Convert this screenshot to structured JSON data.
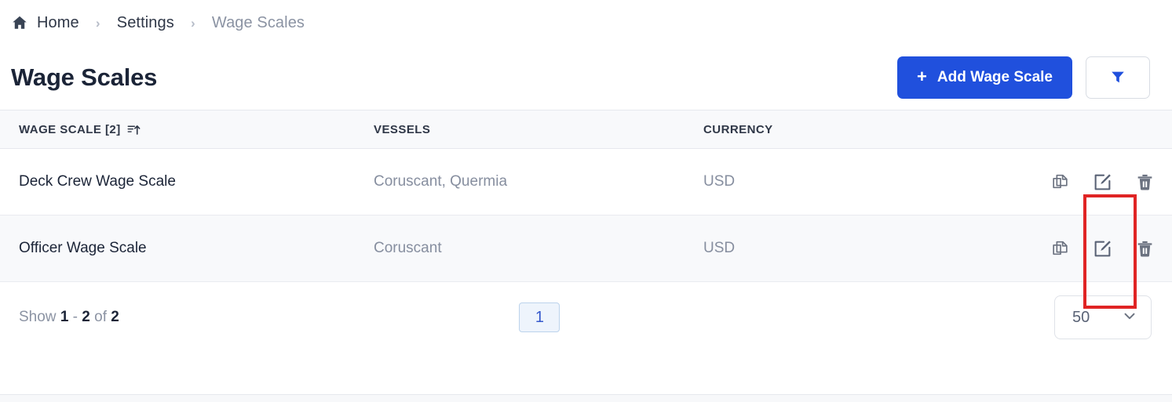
{
  "breadcrumb": {
    "home_icon": "home-icon",
    "separator": "›",
    "items": [
      {
        "label": "Home",
        "muted": false
      },
      {
        "label": "Settings",
        "muted": false
      },
      {
        "label": "Wage Scales",
        "muted": true
      }
    ]
  },
  "header": {
    "title": "Wage Scales",
    "add_button": {
      "plus": "+",
      "label": "Add Wage Scale",
      "color": "#2050dd"
    },
    "filter_button": {
      "icon": "filter-funnel-icon",
      "color": "#2050dd"
    }
  },
  "table": {
    "columns": [
      {
        "label": "WAGE SCALE [2]",
        "sort_icon": "sort-ascending-icon"
      },
      {
        "label": "VESSELS"
      },
      {
        "label": "CURRENCY"
      }
    ],
    "rows": [
      {
        "name": "Deck Crew Wage Scale",
        "vessels": "Coruscant, Quermia",
        "currency": "USD"
      },
      {
        "name": "Officer Wage Scale",
        "vessels": "Coruscant",
        "currency": "USD"
      }
    ],
    "row_actions": [
      {
        "icon": "copy-icon",
        "title": "Copy"
      },
      {
        "icon": "edit-icon",
        "title": "Edit"
      },
      {
        "icon": "delete-icon",
        "title": "Delete"
      }
    ]
  },
  "footer": {
    "show_prefix": "Show",
    "range_start": "1",
    "range_dash": "-",
    "range_end": "2",
    "of_word": "of",
    "total": "2",
    "current_page": "1",
    "rows_per_page": "50",
    "chevron": "chevron-down-icon"
  },
  "highlight": {
    "color": "#e02424",
    "target": "edit-icon-column"
  }
}
